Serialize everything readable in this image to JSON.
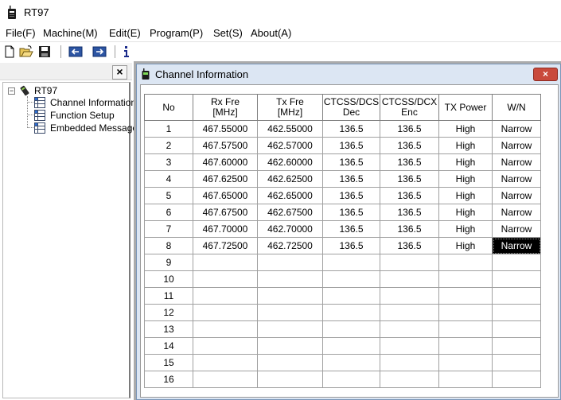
{
  "window": {
    "title": "RT97"
  },
  "menu": [
    {
      "label": "File(F)"
    },
    {
      "label": "Machine(M)"
    },
    {
      "label": "Edit(E)"
    },
    {
      "label": "Program(P)"
    },
    {
      "label": "Set(S)"
    },
    {
      "label": "About(A)"
    }
  ],
  "toolbar": {
    "icons": [
      "new-file-icon",
      "open-folder-icon",
      "save-icon",
      "read-radio-icon",
      "write-radio-icon",
      "info-icon"
    ]
  },
  "left_panel": {
    "close_symbol": "×",
    "tree": {
      "expand_symbol": "−",
      "root": "RT97",
      "children": [
        "Channel Information",
        "Function Setup",
        "Embedded Message"
      ]
    }
  },
  "child_window": {
    "title": "Channel Information",
    "close_symbol": "×"
  },
  "table": {
    "headers": [
      {
        "line1": "No",
        "line2": ""
      },
      {
        "line1": "Rx Fre",
        "line2": "[MHz]"
      },
      {
        "line1": "Tx Fre",
        "line2": "[MHz]"
      },
      {
        "line1": "CTCSS/DCS",
        "line2": "Dec"
      },
      {
        "line1": "CTCSS/DCX",
        "line2": "Enc"
      },
      {
        "line1": "TX Power",
        "line2": ""
      },
      {
        "line1": "W/N",
        "line2": ""
      }
    ],
    "selected": {
      "row": 7,
      "col": 6
    },
    "rows": [
      [
        "1",
        "467.55000",
        "462.55000",
        "136.5",
        "136.5",
        "High",
        "Narrow"
      ],
      [
        "2",
        "467.57500",
        "462.57000",
        "136.5",
        "136.5",
        "High",
        "Narrow"
      ],
      [
        "3",
        "467.60000",
        "462.60000",
        "136.5",
        "136.5",
        "High",
        "Narrow"
      ],
      [
        "4",
        "467.62500",
        "462.62500",
        "136.5",
        "136.5",
        "High",
        "Narrow"
      ],
      [
        "5",
        "467.65000",
        "462.65000",
        "136.5",
        "136.5",
        "High",
        "Narrow"
      ],
      [
        "6",
        "467.67500",
        "462.67500",
        "136.5",
        "136.5",
        "High",
        "Narrow"
      ],
      [
        "7",
        "467.70000",
        "462.70000",
        "136.5",
        "136.5",
        "High",
        "Narrow"
      ],
      [
        "8",
        "467.72500",
        "462.72500",
        "136.5",
        "136.5",
        "High",
        "Narrow"
      ],
      [
        "9",
        "",
        "",
        "",
        "",
        "",
        ""
      ],
      [
        "10",
        "",
        "",
        "",
        "",
        "",
        ""
      ],
      [
        "11",
        "",
        "",
        "",
        "",
        "",
        ""
      ],
      [
        "12",
        "",
        "",
        "",
        "",
        "",
        ""
      ],
      [
        "13",
        "",
        "",
        "",
        "",
        "",
        ""
      ],
      [
        "14",
        "",
        "",
        "",
        "",
        "",
        ""
      ],
      [
        "15",
        "",
        "",
        "",
        "",
        "",
        ""
      ],
      [
        "16",
        "",
        "",
        "",
        "",
        "",
        ""
      ]
    ]
  }
}
